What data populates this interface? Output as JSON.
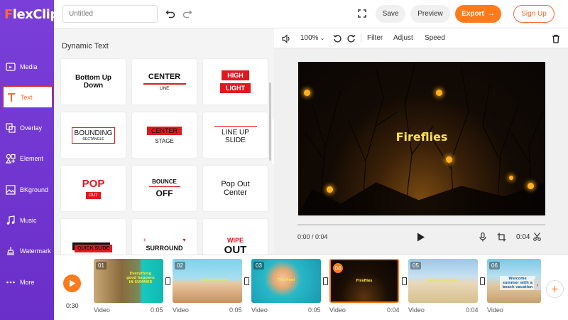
{
  "app": {
    "logo_prefix": "F",
    "logo_rest": "lexClip"
  },
  "header": {
    "title_placeholder": "Untitled",
    "save_label": "Save",
    "preview_label": "Preview",
    "export_label": "Export",
    "signup_label": "Sign Up"
  },
  "sidebar": {
    "items": [
      {
        "label": "Media",
        "icon": "media-icon"
      },
      {
        "label": "Text",
        "icon": "text-icon",
        "active": true
      },
      {
        "label": "Overlay",
        "icon": "overlay-icon"
      },
      {
        "label": "Element",
        "icon": "element-icon"
      },
      {
        "label": "BKground",
        "icon": "background-icon"
      },
      {
        "label": "Music",
        "icon": "music-icon"
      },
      {
        "label": "Watermark",
        "icon": "watermark-icon"
      },
      {
        "label": "More",
        "icon": "more-icon"
      }
    ]
  },
  "panel": {
    "title": "Dynamic Text",
    "cards": [
      {
        "lines": [
          "Bottom Up",
          "Down"
        ]
      },
      {
        "lines": [
          "CENTER",
          "LINE"
        ]
      },
      {
        "lines": [
          "HIGH",
          "LIGHT"
        ]
      },
      {
        "lines": [
          "BOUNDING",
          "RECTANGLE"
        ]
      },
      {
        "lines": [
          "CENTER",
          "STAGE"
        ]
      },
      {
        "lines": [
          "LINE UP",
          "SLIDE"
        ]
      },
      {
        "lines": [
          "POP",
          "OUT"
        ]
      },
      {
        "lines": [
          "BOUNCE",
          "OFF"
        ]
      },
      {
        "lines": [
          "Pop Out",
          "Center"
        ]
      },
      {
        "lines": [
          "QUICK SLIDE"
        ]
      },
      {
        "lines": [
          "SURROUND"
        ]
      },
      {
        "lines": [
          "WIPE",
          "OUT"
        ]
      }
    ]
  },
  "toolbar": {
    "zoom": "100%",
    "filter_label": "Filter",
    "adjust_label": "Adjust",
    "speed_label": "Speed"
  },
  "player": {
    "title": "Fireflies",
    "current_time": "0:00 / 0:04",
    "clip_duration": "0:04",
    "progress": 0
  },
  "timeline": {
    "total_time": "0:30",
    "clips": [
      {
        "num": "01",
        "caption": "Everything good happens IN SUMMER",
        "type": "Video",
        "duration": "0:05"
      },
      {
        "num": "02",
        "caption": "Summertime",
        "type": "Video",
        "duration": "0:05"
      },
      {
        "num": "03",
        "caption": "The Pool",
        "type": "Video",
        "duration": "0:05"
      },
      {
        "num": "04",
        "caption": "Fireflies",
        "type": "Video",
        "duration": "0:04",
        "selected": true
      },
      {
        "num": "05",
        "caption": "Family Vacation",
        "type": "Video",
        "duration": "0:04"
      },
      {
        "num": "06",
        "caption": "Welcome summer with a beach vacation",
        "type": "Video",
        "duration": ""
      }
    ]
  },
  "colors": {
    "accent": "#ff7a1a",
    "sidebar": "#6a2fc9",
    "highlight_red": "#e0191f"
  }
}
